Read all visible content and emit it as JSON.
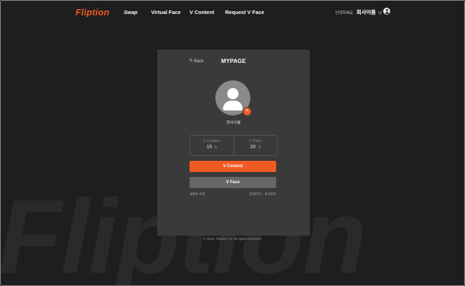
{
  "brand": {
    "logo": "Fliption",
    "watermark": "Fliption",
    "accent": "#f05a24"
  },
  "nav": [
    {
      "label": "Swap"
    },
    {
      "label": "Virtual Face"
    },
    {
      "label": "V Content"
    },
    {
      "label": "Request V Face"
    }
  ],
  "header": {
    "greeting": "안녕하세요.",
    "user_name": "회사이름",
    "honorific": "님"
  },
  "card": {
    "back_label": "Back",
    "title": "MYPAGE",
    "profile_name": "회사이름",
    "stats": [
      {
        "label": "V Content",
        "value": "15",
        "unit": "개"
      },
      {
        "label": "V Face",
        "value": "20",
        "unit": "개"
      }
    ],
    "btn_vcontent": "V Content",
    "btn_vface": "V Face",
    "edit_info": "내정보 수정",
    "inquiry": "문의하기",
    "divider": "|",
    "logout": "로그아웃"
  },
  "footer": {
    "copyright": "© 2021. Fliption Co. all rights reserved."
  }
}
